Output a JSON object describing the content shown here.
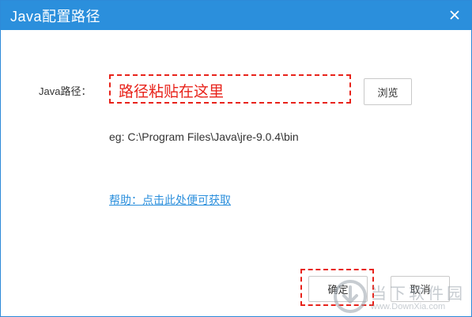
{
  "window": {
    "title": "Java配置路径",
    "close_icon": "close-icon"
  },
  "form": {
    "path_label": "Java路径：",
    "path_value": "路径粘贴在这里",
    "browse_label": "浏览",
    "example": "eg: C:\\Program Files\\Java\\jre-9.0.4\\bin",
    "help_link": "帮助：点击此处便可获取"
  },
  "footer": {
    "ok_label": "确定",
    "cancel_label": "取消"
  },
  "watermark": {
    "name_cn": "当下软件园",
    "name_en": "www.DownXia.com",
    "icon": "downxia-logo"
  },
  "colors": {
    "titlebar": "#2b8fdc",
    "annotation": "#e8231b",
    "link": "#2b8fdc"
  }
}
